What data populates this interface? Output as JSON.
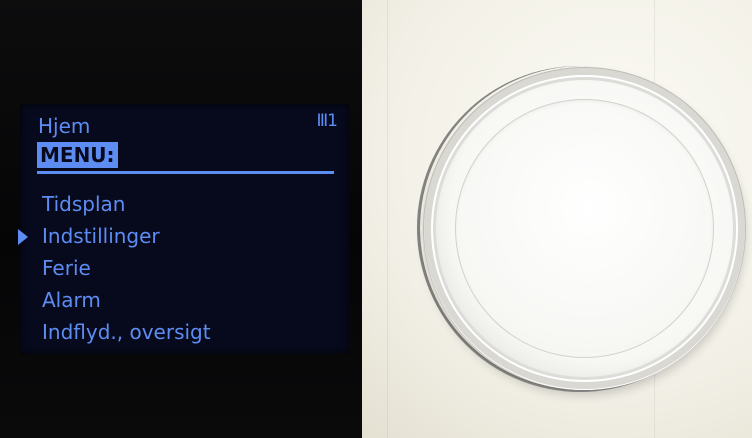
{
  "screen": {
    "title": "Hjem",
    "badge": "Ⅲ1",
    "menu_header": "MENU:",
    "selected_index": 1,
    "items": [
      {
        "label": "Tidsplan"
      },
      {
        "label": "Indstillinger"
      },
      {
        "label": "Ferie"
      },
      {
        "label": "Alarm"
      },
      {
        "label": "Indflyd., oversigt"
      }
    ]
  },
  "colors": {
    "display_text": "#5d8cf2",
    "display_background": "#070a1d",
    "device_bezel": "#050506",
    "device_body": "#f1efe6",
    "dial": "#f7f7f4"
  },
  "icons": {
    "selector": "triangle-right-icon",
    "badge": "radiator-icon"
  }
}
